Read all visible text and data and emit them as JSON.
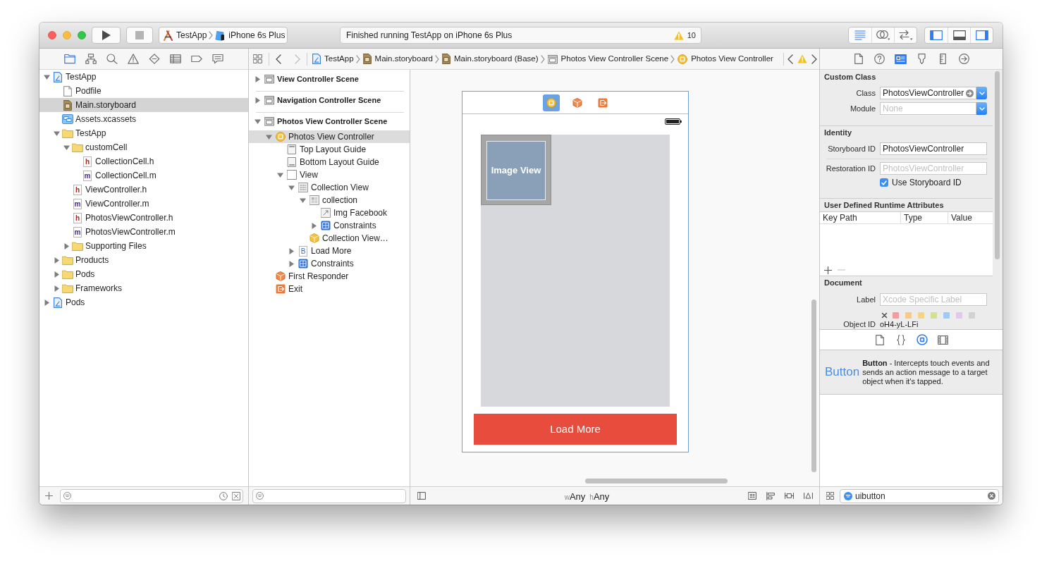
{
  "toolbar": {
    "run_controls": [
      {
        "kind": "run",
        "disabled": false
      },
      {
        "kind": "stop",
        "disabled": true
      }
    ],
    "scheme": {
      "target": "TestApp",
      "device": "iPhone 6s Plus"
    },
    "activity": {
      "status": "Finished running TestApp on iPhone 6s Plus",
      "warning_count": "10"
    },
    "editor_modes": [
      {
        "kind": "standard",
        "selected": true
      },
      {
        "kind": "assistant",
        "selected": false
      },
      {
        "kind": "version",
        "selected": false
      }
    ],
    "panels": [
      {
        "kind": "navigator",
        "on": true
      },
      {
        "kind": "debug",
        "on": false
      },
      {
        "kind": "utilities",
        "on": true
      }
    ]
  },
  "navigator": {
    "tabs": [
      {
        "kind": "project",
        "selected": true
      },
      {
        "kind": "symbol",
        "selected": false
      },
      {
        "kind": "find",
        "selected": false
      },
      {
        "kind": "issue",
        "selected": false
      },
      {
        "kind": "test",
        "selected": false
      },
      {
        "kind": "debug",
        "selected": false
      },
      {
        "kind": "breakpoint",
        "selected": false
      },
      {
        "kind": "report",
        "selected": false
      }
    ],
    "tree": [
      {
        "name": "TestApp",
        "kind": "project",
        "expanded": true,
        "selected": false,
        "children": [
          {
            "name": "Podfile",
            "kind": "file",
            "selected": false
          },
          {
            "name": "Main.storyboard",
            "kind": "storyboard",
            "selected": true
          },
          {
            "name": "Assets.xcassets",
            "kind": "assets",
            "selected": false
          },
          {
            "name": "TestApp",
            "kind": "folder",
            "expanded": true,
            "selected": false,
            "children": [
              {
                "name": "customCell",
                "kind": "folder",
                "expanded": true,
                "selected": false,
                "children": [
                  {
                    "name": "CollectionCell.h",
                    "kind": "header",
                    "icon_letter": "h",
                    "selected": false
                  },
                  {
                    "name": "CollectionCell.m",
                    "kind": "source",
                    "icon_letter": "m",
                    "selected": false
                  }
                ]
              },
              {
                "name": "ViewController.h",
                "kind": "header",
                "icon_letter": "h",
                "selected": false
              },
              {
                "name": "ViewController.m",
                "kind": "source",
                "icon_letter": "m",
                "selected": false
              },
              {
                "name": "PhotosViewController.h",
                "kind": "header",
                "icon_letter": "h",
                "selected": false
              },
              {
                "name": "PhotosViewController.m",
                "kind": "source",
                "icon_letter": "m",
                "selected": false
              },
              {
                "name": "Supporting Files",
                "kind": "folder",
                "expanded": false,
                "selected": false
              }
            ]
          },
          {
            "name": "Products",
            "kind": "folder",
            "expanded": false,
            "selected": false
          },
          {
            "name": "Pods",
            "kind": "folder",
            "expanded": false,
            "selected": false
          },
          {
            "name": "Frameworks",
            "kind": "folder",
            "expanded": false,
            "selected": false
          }
        ]
      },
      {
        "name": "Pods",
        "kind": "project",
        "expanded": false,
        "selected": false
      }
    ]
  },
  "jump_bar": {
    "history": [
      {
        "kind": "back",
        "disabled": false
      },
      {
        "kind": "forward",
        "disabled": true
      }
    ],
    "path": [
      {
        "label": "TestApp",
        "kind": "project"
      },
      {
        "label": "Main.storyboard",
        "kind": "storyboard"
      },
      {
        "label": "Main.storyboard (Base)",
        "kind": "storyboard"
      },
      {
        "label": "Photos View Controller Scene",
        "kind": "scene"
      },
      {
        "label": "Photos View Controller",
        "kind": "controller"
      }
    ]
  },
  "outline": {
    "scenes": [
      {
        "name": "View Controller Scene",
        "expanded": false,
        "selected": false
      },
      {
        "name": "Navigation Controller Scene",
        "expanded": false,
        "selected": false
      },
      {
        "name": "Photos View Controller Scene",
        "expanded": true,
        "selected": false,
        "children": [
          {
            "name": "Photos View Controller",
            "kind": "controller",
            "expanded": true,
            "selected": true,
            "children": [
              {
                "name": "Top Layout Guide",
                "kind": "top_guide",
                "selected": false
              },
              {
                "name": "Bottom Layout Guide",
                "kind": "bottom_guide",
                "selected": false
              },
              {
                "name": "View",
                "kind": "view",
                "expanded": true,
                "selected": false,
                "children": [
                  {
                    "name": "Collection View",
                    "kind": "collection_view",
                    "expanded": true,
                    "selected": false,
                    "children": [
                      {
                        "name": "collection",
                        "kind": "cell",
                        "expanded": true,
                        "selected": false,
                        "children": [
                          {
                            "name": "Img Facebook",
                            "kind": "image_view",
                            "selected": false
                          },
                          {
                            "name": "Constraints",
                            "kind": "constraints",
                            "expanded": false,
                            "selected": false
                          }
                        ]
                      },
                      {
                        "name": "Collection View…",
                        "kind": "flow_layout",
                        "selected": false
                      }
                    ]
                  },
                  {
                    "name": "Load More",
                    "kind": "button",
                    "icon_letter": "B",
                    "expanded": false,
                    "selected": false
                  },
                  {
                    "name": "Constraints",
                    "kind": "constraints",
                    "expanded": false,
                    "selected": false
                  }
                ]
              }
            ]
          },
          {
            "name": "First Responder",
            "kind": "first_responder",
            "selected": false
          },
          {
            "name": "Exit",
            "kind": "exit",
            "selected": false
          }
        ]
      }
    ]
  },
  "canvas": {
    "dock": [
      {
        "kind": "controller",
        "selected": true
      },
      {
        "kind": "first_responder",
        "selected": false
      },
      {
        "kind": "exit",
        "selected": false
      }
    ],
    "cell_label": "Image View",
    "button_label": "Load More",
    "size_class": {
      "width_prefix": "w",
      "width": "Any",
      "height_prefix": "h",
      "height": "Any"
    }
  },
  "inspector": {
    "tabs": [
      {
        "kind": "file",
        "selected": false
      },
      {
        "kind": "help",
        "selected": false
      },
      {
        "kind": "identity",
        "selected": true
      },
      {
        "kind": "attributes",
        "selected": false
      },
      {
        "kind": "size",
        "selected": false
      },
      {
        "kind": "connections",
        "selected": false
      }
    ],
    "custom_class": {
      "title": "Custom Class",
      "class": {
        "label": "Class",
        "value": "PhotosViewController"
      },
      "module": {
        "label": "Module",
        "placeholder": "None"
      }
    },
    "identity": {
      "title": "Identity",
      "storyboard_id": {
        "label": "Storyboard ID",
        "value": "PhotosViewController"
      },
      "restoration_id": {
        "label": "Restoration ID",
        "placeholder": "PhotosViewController"
      },
      "use_storyboard_id": {
        "label": "Use Storyboard ID",
        "checked": true
      }
    },
    "runtime_attributes": {
      "title": "User Defined Runtime Attributes",
      "columns": [
        "Key Path",
        "Type",
        "Value"
      ]
    },
    "document": {
      "title": "Document",
      "label": {
        "label": "Label",
        "placeholder": "Xcode Specific Label"
      },
      "label_colors": [
        {
          "color": "#f39c9c"
        },
        {
          "color": "#f7c98a"
        },
        {
          "color": "#f5d48a"
        },
        {
          "color": "#cfe291"
        },
        {
          "color": "#9ecbf3"
        },
        {
          "color": "#e3c8ec"
        },
        {
          "color": "#d2d2d2"
        }
      ],
      "object_id": {
        "label": "Object ID",
        "value": "oH4-yL-LFi"
      }
    }
  },
  "library": {
    "tabs": [
      {
        "kind": "file_template",
        "selected": false
      },
      {
        "kind": "code_snippet",
        "selected": false
      },
      {
        "kind": "object",
        "selected": true
      },
      {
        "kind": "media",
        "selected": false
      }
    ],
    "preview": "Button",
    "description": "**Button** - Intercepts touch events and sends an action message to a target object when it's tapped.",
    "filter": {
      "value": "uibutton"
    }
  }
}
